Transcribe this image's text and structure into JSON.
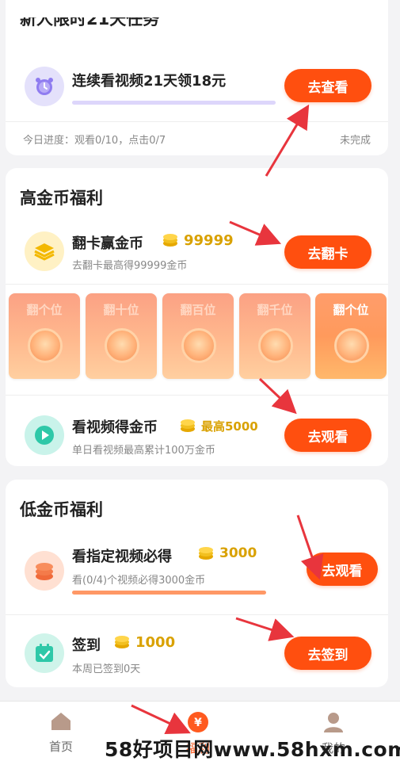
{
  "colors": {
    "accent": "#ff4f0f",
    "coin": "#d9a100",
    "arrow": "#e8353d"
  },
  "task21": {
    "section_title": "新人限时21天任务",
    "title": "连续看视频21天领18元",
    "button": "去查看",
    "progress": "今日进度：观看0/10，点击0/7",
    "status": "未完成"
  },
  "high": {
    "section_title": "高金币福利",
    "flip": {
      "title": "翻卡赢金币",
      "amount": "99999",
      "desc": "去翻卡最高得99999金币",
      "button": "去翻卡",
      "cards": [
        "翻个位",
        "翻十位",
        "翻百位",
        "翻千位",
        "翻个位"
      ]
    },
    "video": {
      "title": "看视频得金币",
      "amount": "最高5000",
      "desc": "单日看视频最高累计100万金币",
      "button": "去观看"
    }
  },
  "low": {
    "section_title": "低金币福利",
    "specified": {
      "title": "看指定视频必得",
      "amount": "3000",
      "desc": "看(0/4)个视频必得3000金币",
      "button": "去观看",
      "progress": 0
    },
    "checkin": {
      "title": "签到",
      "amount": "1000",
      "desc": "本周已签到0天",
      "button": "去签到"
    }
  },
  "nav": {
    "home": "首页",
    "welfare": "福利",
    "mine": "我的"
  },
  "watermark": "58好项目网www.58hxm.com"
}
